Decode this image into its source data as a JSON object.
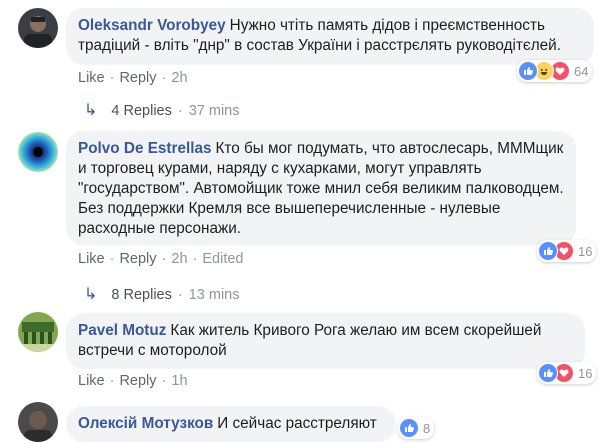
{
  "comments": [
    {
      "author": "Oleksandr Vorobyey",
      "text": "Нужно чтіть память дідов і преємственность традіций - вліть \"днр\" в состав України і расстрєлять руководітєлей.",
      "like": "Like",
      "reply": "Reply",
      "time": "2h",
      "reaction_count": "64",
      "replies_label": "4 Replies",
      "replies_time": "37 mins"
    },
    {
      "author": "Polvo De Estrellas",
      "text": "Кто бы мог подумать, что автослесарь, МММщик и торговец курами, наряду с кухарками, могут управлять \"государством\". Автомойщик тоже мнил себя великим палководцем. Без поддержки Кремля все вышеперечисленные - нулевые расходные персонажи.",
      "like": "Like",
      "reply": "Reply",
      "time": "2h",
      "edited": "Edited",
      "reaction_count": "16",
      "replies_label": "8 Replies",
      "replies_time": "13 mins"
    },
    {
      "author": "Pavel Motuz",
      "text": "Как житель Кривого Рога желаю им всем скорейшей встречи с моторолой",
      "like": "Like",
      "reply": "Reply",
      "time": "1h",
      "reaction_count": "16"
    },
    {
      "author": "Олексій Мотузков",
      "text": "И сейчас расстреляют",
      "reaction_count": "8"
    }
  ],
  "colors": {
    "like_blue": "#5890ff",
    "love_red": "#f25268",
    "haha_yellow": "#fcd462",
    "author_link": "#385898",
    "bubble_bg": "#f2f3f5"
  }
}
